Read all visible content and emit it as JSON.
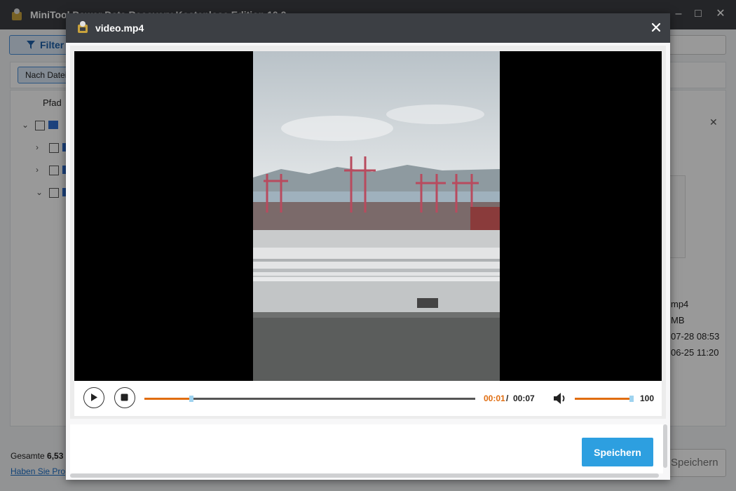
{
  "app": {
    "title": "MiniTool Power Data Recovery Kostenlose Edition 10.2",
    "filter_label": "Filter",
    "sort_label": "Nach Datei",
    "column_path": "Pfad",
    "meta_lines": [
      "mp4",
      "MB",
      "07-28 08:53",
      "06-25 11:20"
    ],
    "footer_total_label": "Gesamte",
    "footer_total_value": "6,53",
    "footer_link": "Haben Sie Pro",
    "save_label": "Speichern"
  },
  "dialog": {
    "title": "video.mp4",
    "time_current": "00:01",
    "time_separator": "/",
    "time_duration": "00:07",
    "progress_fraction": 0.143,
    "volume": "100",
    "volume_fraction": 1.0,
    "save_label": "Speichern"
  },
  "colors": {
    "accent": "#e06d10",
    "primary_button": "#2d9fe0",
    "titlebar": "#3c3f44"
  },
  "icons": {
    "app_logo": "app-logo-icon",
    "play": "play-icon",
    "stop": "stop-icon",
    "volume": "volume-icon",
    "close": "close-icon",
    "filter": "filter-icon"
  }
}
